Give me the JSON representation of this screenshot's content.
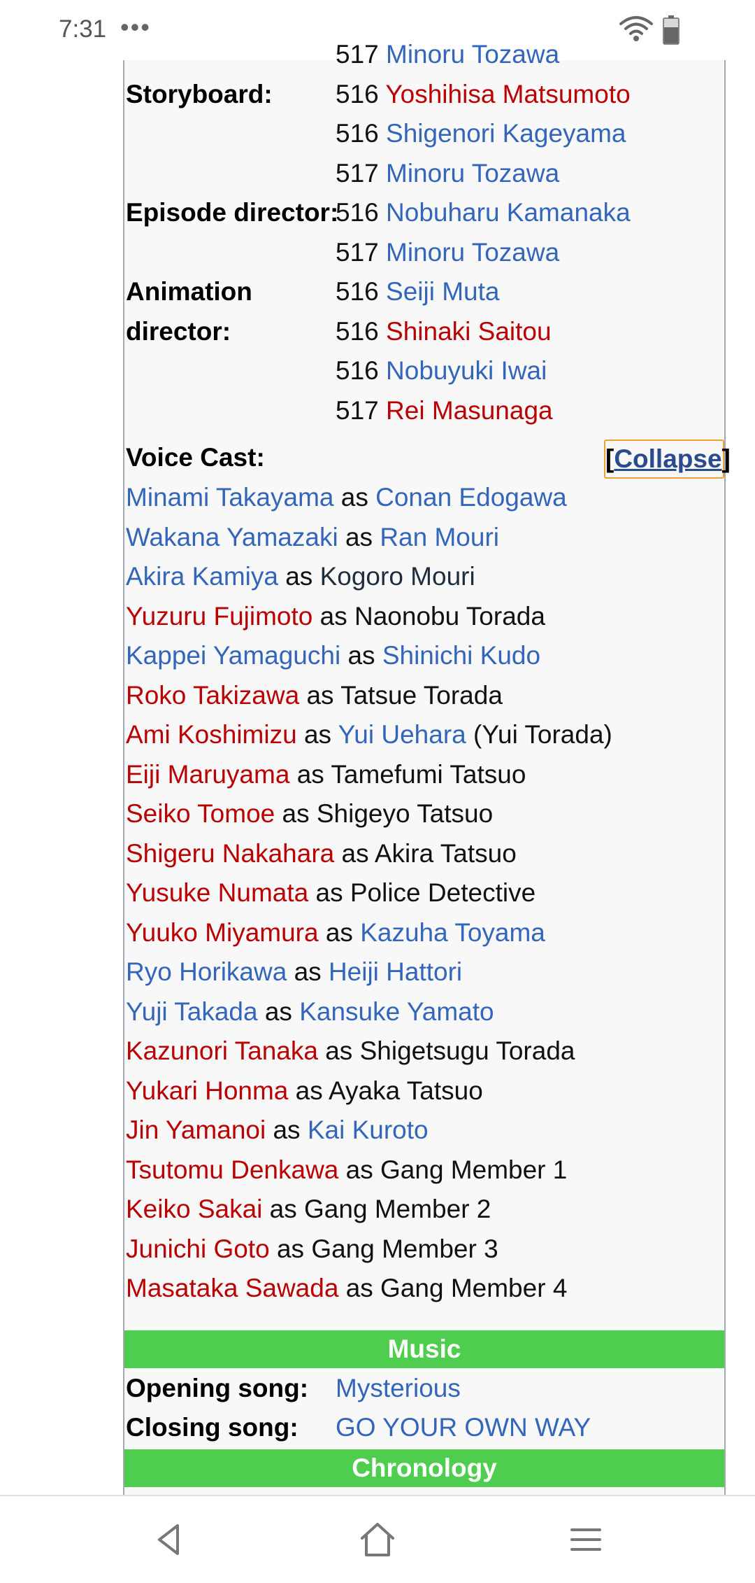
{
  "status_bar": {
    "time": "7:31",
    "dots": "•••"
  },
  "crew": [
    {
      "label": "",
      "ep": "517",
      "name": "Minoru Tozawa",
      "color": "blue"
    },
    {
      "label": "Storyboard:",
      "ep": "516",
      "name": "Yoshihisa Matsumoto",
      "color": "red"
    },
    {
      "label": "",
      "ep": "516",
      "name": "Shigenori Kageyama",
      "color": "blue"
    },
    {
      "label": "",
      "ep": "517",
      "name": "Minoru Tozawa",
      "color": "blue"
    },
    {
      "label": "Episode director:",
      "ep": "516",
      "name": "Nobuharu Kamanaka",
      "color": "blue"
    },
    {
      "label": "",
      "ep": "517",
      "name": "Minoru Tozawa",
      "color": "blue"
    },
    {
      "label": "Animation",
      "ep": "516",
      "name": "Seiji Muta",
      "color": "blue"
    },
    {
      "label": "director:",
      "ep": "516",
      "name": "Shinaki Saitou",
      "color": "red"
    },
    {
      "label": "",
      "ep": "516",
      "name": "Nobuyuki Iwai",
      "color": "blue"
    },
    {
      "label": "",
      "ep": "517",
      "name": "Rei Masunaga",
      "color": "red"
    }
  ],
  "voice_cast": {
    "label": "Voice Cast:",
    "collapse_open": "[",
    "collapse_label": "Collapse",
    "collapse_close": "]",
    "separator": "as",
    "entries": [
      {
        "actor": "Minami Takayama",
        "actor_color": "blue",
        "role": "Conan Edogawa",
        "role_color": "blue",
        "extra": ""
      },
      {
        "actor": "Wakana Yamazaki",
        "actor_color": "blue",
        "role": "Ran Mouri",
        "role_color": "blue",
        "extra": ""
      },
      {
        "actor": "Akira Kamiya",
        "actor_color": "blue",
        "role": "Kogoro Mouri",
        "role_color": "dark",
        "extra": ""
      },
      {
        "actor": "Yuzuru Fujimoto",
        "actor_color": "red",
        "role": "Naonobu Torada",
        "role_color": "plain",
        "extra": ""
      },
      {
        "actor": "Kappei Yamaguchi",
        "actor_color": "blue",
        "role": "Shinichi Kudo",
        "role_color": "blue",
        "extra": ""
      },
      {
        "actor": "Roko Takizawa",
        "actor_color": "red",
        "role": "Tatsue Torada",
        "role_color": "plain",
        "extra": ""
      },
      {
        "actor": "Ami Koshimizu",
        "actor_color": "red",
        "role": "Yui Uehara",
        "role_color": "blue",
        "extra": "(Yui Torada)"
      },
      {
        "actor": "Eiji Maruyama",
        "actor_color": "red",
        "role": "Tamefumi Tatsuo",
        "role_color": "plain",
        "extra": ""
      },
      {
        "actor": "Seiko Tomoe",
        "actor_color": "red",
        "role": "Shigeyo Tatsuo",
        "role_color": "plain",
        "extra": ""
      },
      {
        "actor": "Shigeru Nakahara",
        "actor_color": "red",
        "role": "Akira Tatsuo",
        "role_color": "plain",
        "extra": ""
      },
      {
        "actor": "Yusuke Numata",
        "actor_color": "red",
        "role": "Police Detective",
        "role_color": "plain",
        "extra": ""
      },
      {
        "actor": "Yuuko Miyamura",
        "actor_color": "red",
        "role": "Kazuha Toyama",
        "role_color": "blue",
        "extra": ""
      },
      {
        "actor": "Ryo Horikawa",
        "actor_color": "blue",
        "role": "Heiji Hattori",
        "role_color": "blue",
        "extra": ""
      },
      {
        "actor": "Yuji Takada",
        "actor_color": "blue",
        "role": "Kansuke Yamato",
        "role_color": "blue",
        "extra": ""
      },
      {
        "actor": "Kazunori Tanaka",
        "actor_color": "red",
        "role": "Shigetsugu Torada",
        "role_color": "plain",
        "extra": ""
      },
      {
        "actor": "Yukari Honma",
        "actor_color": "red",
        "role": "Ayaka Tatsuo",
        "role_color": "plain",
        "extra": ""
      },
      {
        "actor": "Jin Yamanoi",
        "actor_color": "red",
        "role": "Kai Kuroto",
        "role_color": "blue",
        "extra": ""
      },
      {
        "actor": "Tsutomu Denkawa",
        "actor_color": "red",
        "role": "Gang Member 1",
        "role_color": "plain",
        "extra": ""
      },
      {
        "actor": "Keiko Sakai",
        "actor_color": "red",
        "role": "Gang Member 2",
        "role_color": "plain",
        "extra": ""
      },
      {
        "actor": "Junichi Goto",
        "actor_color": "red",
        "role": "Gang Member 3",
        "role_color": "plain",
        "extra": ""
      },
      {
        "actor": "Masataka Sawada",
        "actor_color": "red",
        "role": "Gang Member 4",
        "role_color": "plain",
        "extra": ""
      }
    ]
  },
  "music": {
    "header": "Music",
    "opening_label": "Opening song:",
    "opening_value": "Mysterious",
    "closing_label": "Closing song:",
    "closing_value": "GO YOUR OWN WAY"
  },
  "chronology": {
    "header": "Chronology"
  },
  "colors": {
    "link_blue": "#3366bb",
    "link_red": "#ba0000",
    "header_green": "#4fcd4f"
  },
  "nav_icons": [
    "back-icon",
    "home-icon",
    "menu-icon"
  ]
}
